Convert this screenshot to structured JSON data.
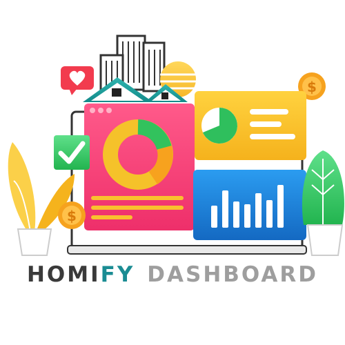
{
  "logo": {
    "word_part_1": "HOMI",
    "word_part_2": "FY",
    "word_part_3": "DASHBOARD"
  },
  "colors": {
    "wordmark_dark": "#3a3a3a",
    "wordmark_accent": "#1a8c93",
    "wordmark_light": "#9e9e9e",
    "pink_panel": "#f5437a",
    "yellow_card": "#f9c12e",
    "blue_card": "#1e88d8",
    "green_check": "#2fb65a",
    "green_plant": "#3ec96a",
    "coin": "#f6a21e"
  },
  "illustration": {
    "donut_chart_icon": "donut-chart",
    "pie_chart_icon": "pie-chart",
    "bar_chart_icon": "bar-chart",
    "heart_icon": "heart-notification",
    "check_icon": "checkmark",
    "coin_icon": "dollar-coin",
    "buildings_icon": "city-buildings",
    "house_icon": "house",
    "plant_icon": "plant"
  }
}
